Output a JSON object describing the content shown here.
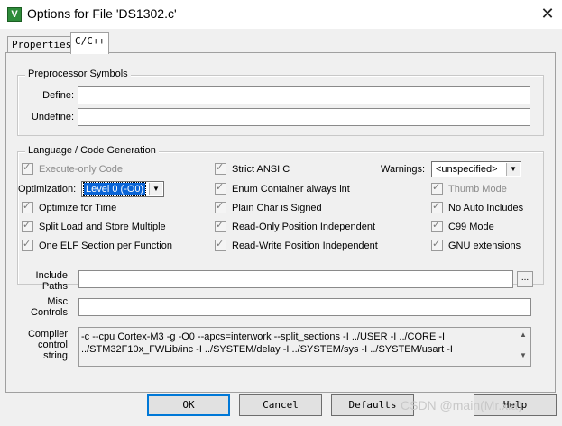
{
  "window": {
    "title": "Options for File 'DS1302.c'",
    "icon": "keil-app-icon",
    "close_glyph": "✕"
  },
  "tabs": [
    {
      "label": "Properties",
      "active": false
    },
    {
      "label": "C/C++",
      "active": true
    }
  ],
  "preprocessor": {
    "title": "Preprocessor Symbols",
    "define_label": "Define:",
    "define_value": "",
    "undefine_label": "Undefine:",
    "undefine_value": ""
  },
  "language": {
    "title": "Language / Code Generation",
    "execute_only": {
      "label": "Execute-only Code",
      "checked": true,
      "disabled": true
    },
    "optimization_label": "Optimization:",
    "optimization_value": "Level 0 (-O0)",
    "optimize_time": {
      "label": "Optimize for Time",
      "checked": true
    },
    "split_load": {
      "label": "Split Load and Store Multiple",
      "checked": true
    },
    "one_elf": {
      "label": "One ELF Section per Function",
      "checked": true
    },
    "strict_ansi": {
      "label": "Strict ANSI C",
      "checked": true
    },
    "enum_container": {
      "label": "Enum Container always int",
      "checked": true
    },
    "plain_char": {
      "label": "Plain Char is Signed",
      "checked": true
    },
    "ro_position": {
      "label": "Read-Only Position Independent",
      "checked": true
    },
    "rw_position": {
      "label": "Read-Write Position Independent",
      "checked": true
    },
    "warnings_label": "Warnings:",
    "warnings_value": "<unspecified>",
    "thumb_mode": {
      "label": "Thumb Mode",
      "checked": true,
      "disabled": true
    },
    "no_auto_includes": {
      "label": "No Auto Includes",
      "checked": true
    },
    "c99_mode": {
      "label": "C99 Mode",
      "checked": true
    },
    "gnu_extensions": {
      "label": "GNU extensions",
      "checked": true
    }
  },
  "paths": {
    "include_label_1": "Include",
    "include_label_2": "Paths",
    "include_value": "",
    "browse_label": "...",
    "misc_label_1": "Misc",
    "misc_label_2": "Controls",
    "misc_value": ""
  },
  "compiler": {
    "label_1": "Compiler",
    "label_2": "control",
    "label_3": "string",
    "line_1": "-c --cpu Cortex-M3 -g -O0 --apcs=interwork --split_sections -I ../USER -I ../CORE -I",
    "line_2": "../STM32F10x_FWLib/inc -I ../SYSTEM/delay -I ../SYSTEM/sys -I ../SYSTEM/usart -I"
  },
  "buttons": {
    "ok": "OK",
    "cancel": "Cancel",
    "defaults": "Defaults",
    "help": "Help"
  },
  "watermark": "CSDN @main(Mr.xia)",
  "check_glyph": "✓",
  "arrow_glyph": "▼"
}
